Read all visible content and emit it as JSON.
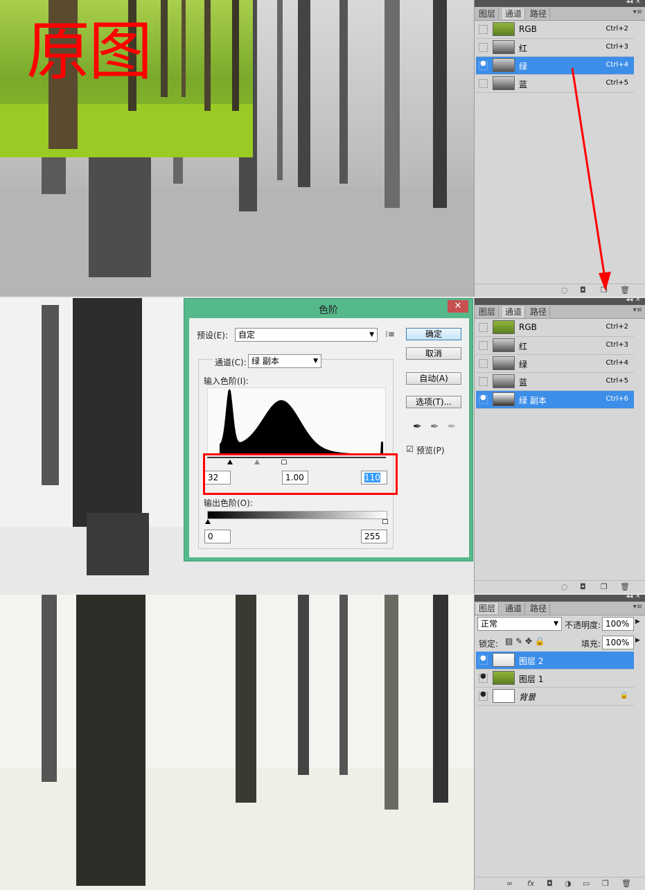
{
  "overlay_text": "原图",
  "panel1": {
    "tabs": [
      "图层",
      "通道",
      "路径"
    ],
    "active_tab": 1,
    "channels": [
      {
        "label": "RGB",
        "shortcut": "Ctrl+2",
        "visible": false,
        "selected": false
      },
      {
        "label": "红",
        "shortcut": "Ctrl+3",
        "visible": false,
        "selected": false
      },
      {
        "label": "绿",
        "shortcut": "Ctrl+4",
        "visible": true,
        "selected": true
      },
      {
        "label": "蓝",
        "shortcut": "Ctrl+5",
        "visible": false,
        "selected": false
      }
    ]
  },
  "panel2": {
    "tabs": [
      "图层",
      "通道",
      "路径"
    ],
    "active_tab": 1,
    "channels": [
      {
        "label": "RGB",
        "shortcut": "Ctrl+2",
        "visible": false,
        "selected": false
      },
      {
        "label": "红",
        "shortcut": "Ctrl+3",
        "visible": false,
        "selected": false
      },
      {
        "label": "绿",
        "shortcut": "Ctrl+4",
        "visible": false,
        "selected": false
      },
      {
        "label": "蓝",
        "shortcut": "Ctrl+5",
        "visible": false,
        "selected": false
      },
      {
        "label": "绿 副本",
        "shortcut": "Ctrl+6",
        "visible": true,
        "selected": true
      }
    ]
  },
  "panel3": {
    "tabs": [
      "图层",
      "通道",
      "路径"
    ],
    "active_tab": 0,
    "blend_mode": "正常",
    "opacity_label": "不透明度:",
    "opacity_value": "100%",
    "lock_label": "锁定:",
    "fill_label": "填充:",
    "fill_value": "100%",
    "layers": [
      {
        "label": "图层 2",
        "visible": true,
        "selected": true
      },
      {
        "label": "图层 1",
        "visible": true,
        "selected": false
      },
      {
        "label": "背景",
        "visible": true,
        "selected": false
      }
    ]
  },
  "dialog": {
    "title": "色阶",
    "preset_label": "预设(E):",
    "preset_value": "自定",
    "channel_label": "通道(C):",
    "channel_value": "绿 副本",
    "input_label": "输入色阶(I):",
    "input_black": "32",
    "input_gamma": "1.00",
    "input_white": "110",
    "output_label": "输出色阶(O):",
    "output_black": "0",
    "output_white": "255",
    "ok": "确定",
    "cancel": "取消",
    "auto": "自动(A)",
    "options": "选项(T)...",
    "preview_label": "预览(P)",
    "preview_checked": true
  },
  "colors": {
    "selection_blue": "#3d8ee8",
    "dialog_green": "#56b98b",
    "annotation_red": "#ff0000"
  }
}
